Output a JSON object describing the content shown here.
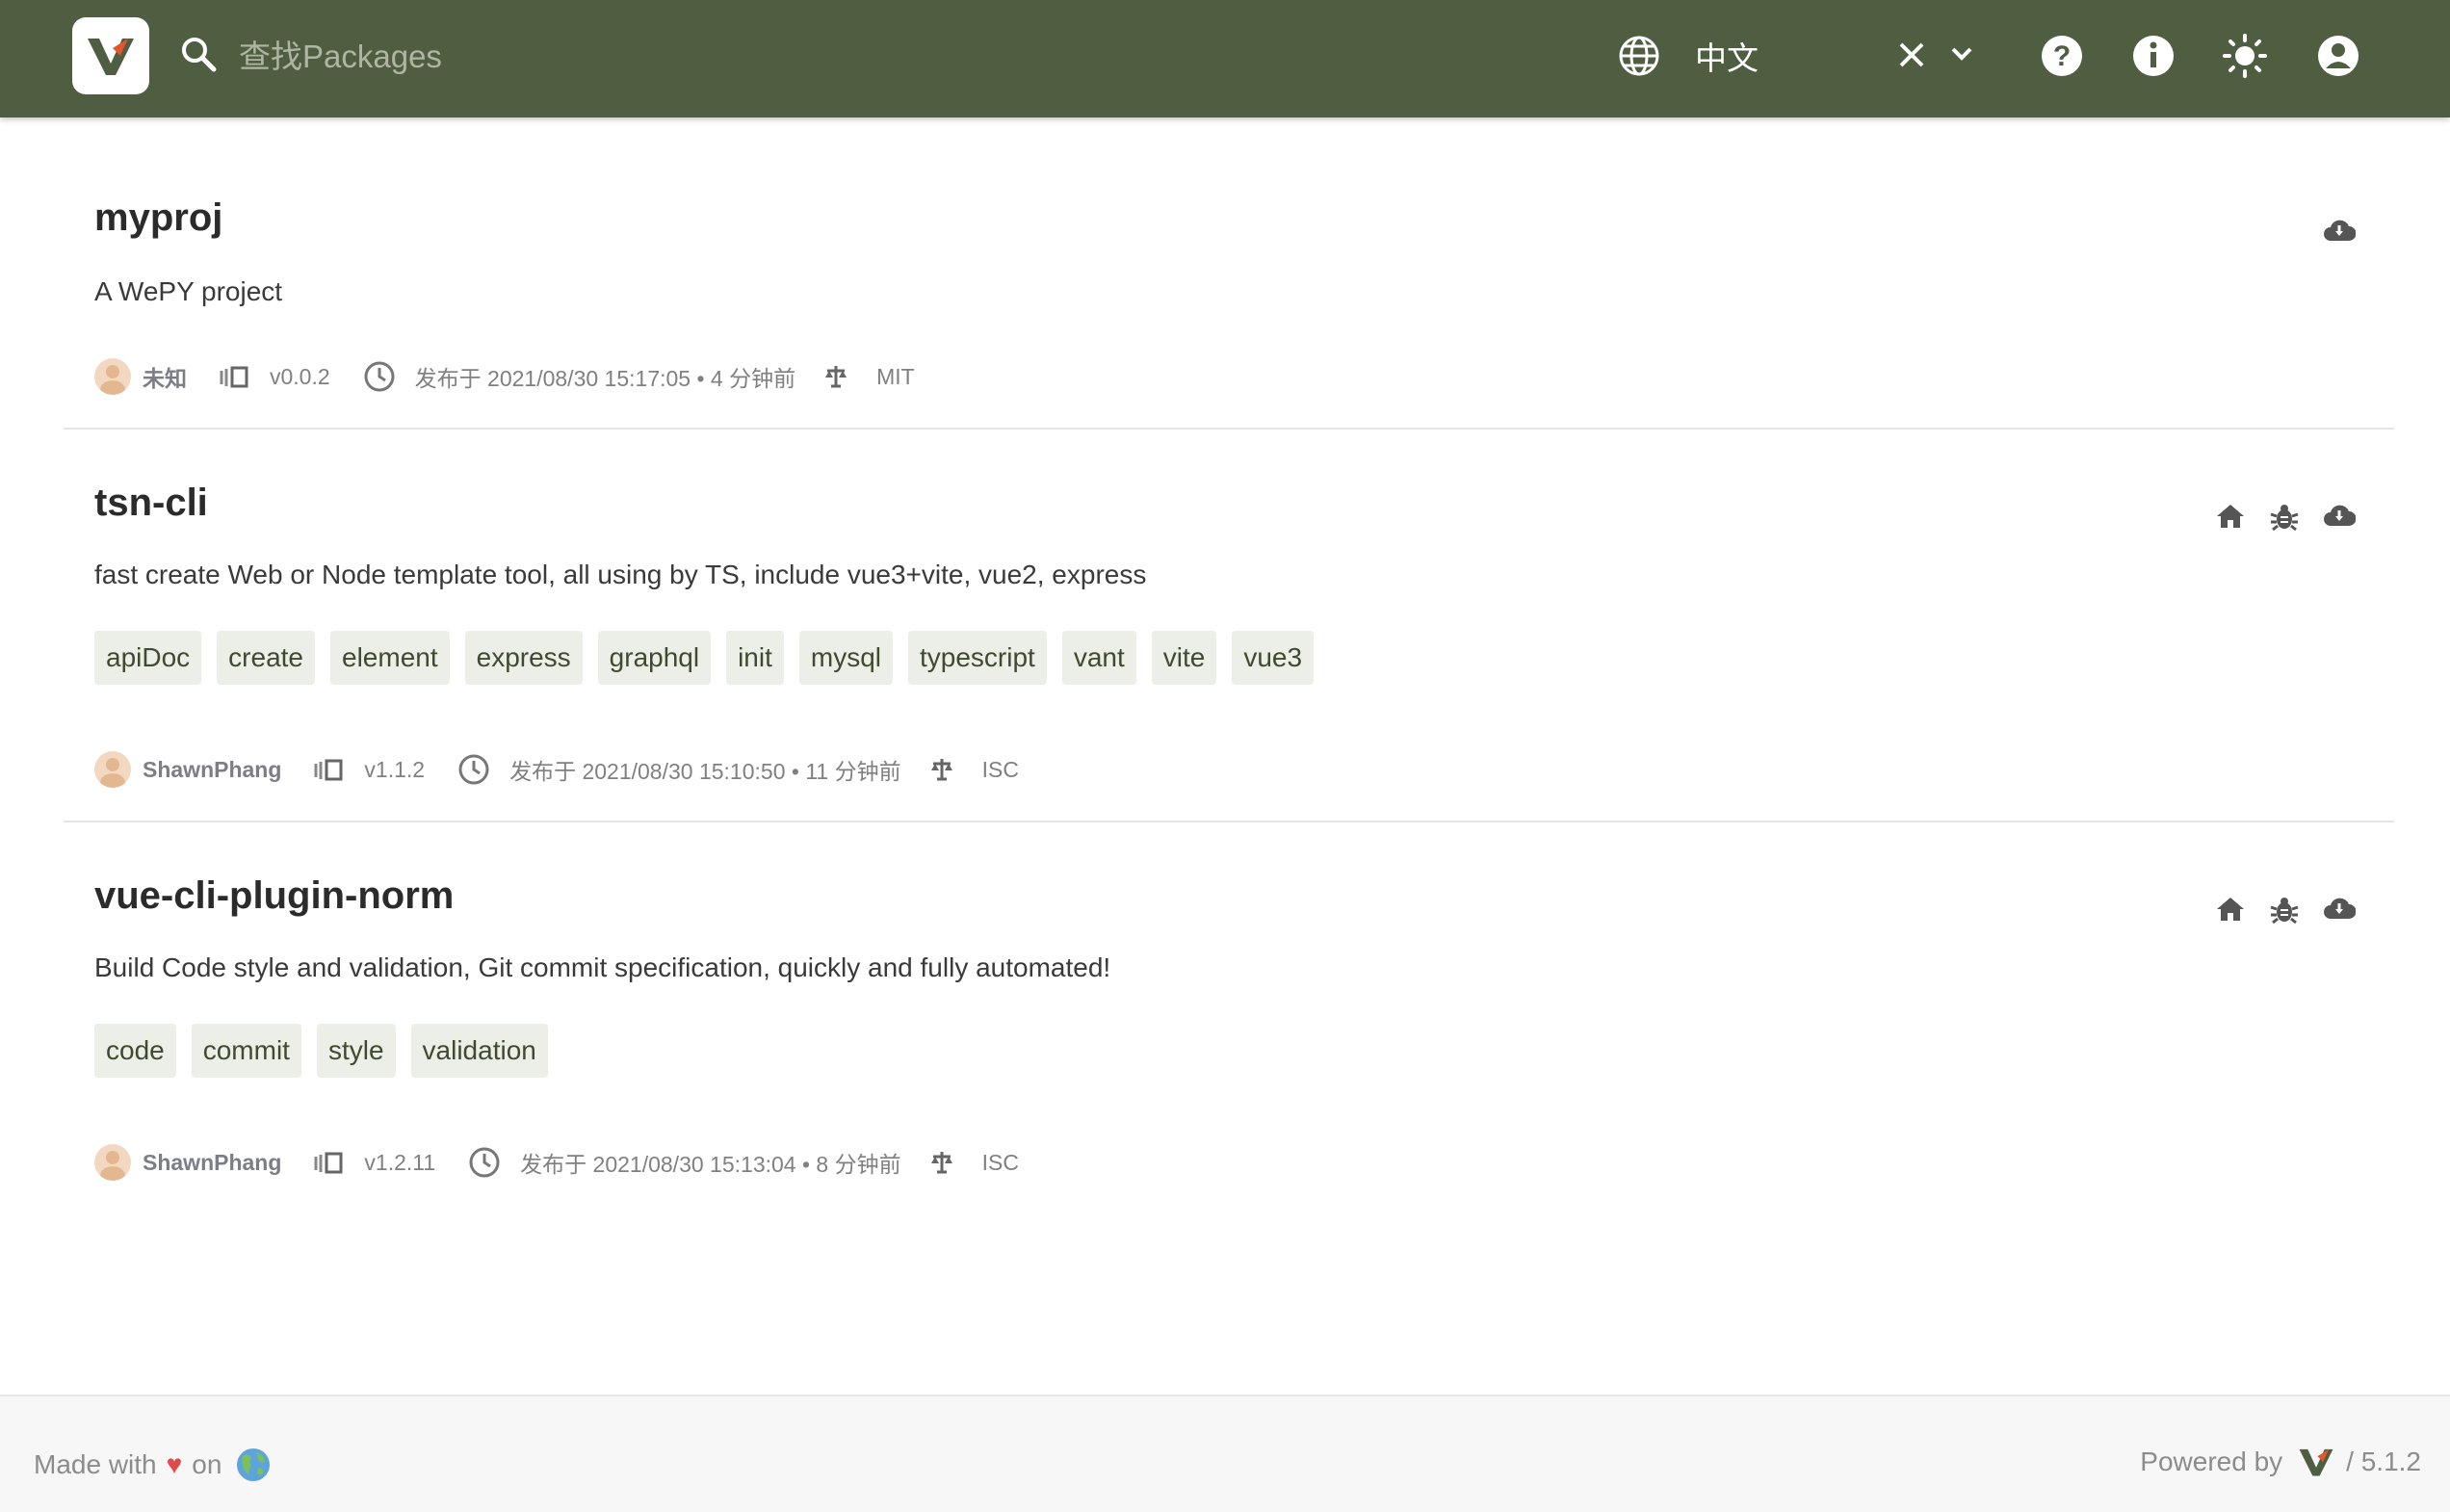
{
  "header": {
    "search_placeholder": "查找Packages",
    "language": "中文",
    "accent_color": "#4f5e40",
    "icons": [
      "search-icon",
      "globe-icon",
      "close-icon",
      "chevron-down-icon",
      "help-icon",
      "info-icon",
      "theme-icon",
      "account-icon"
    ]
  },
  "packages": [
    {
      "name": "myproj",
      "description": "A WePY project",
      "keywords": [],
      "author": "未知",
      "version": "v0.0.2",
      "published": "发布于 2021/08/30 15:17:05 • 4 分钟前",
      "license": "MIT",
      "actions": [
        "download-icon"
      ]
    },
    {
      "name": "tsn-cli",
      "description": "fast create Web or Node template tool, all using by TS, include vue3+vite, vue2, express",
      "keywords": [
        "apiDoc",
        "create",
        "element",
        "express",
        "graphql",
        "init",
        "mysql",
        "typescript",
        "vant",
        "vite",
        "vue3"
      ],
      "author": "ShawnPhang",
      "version": "v1.1.2",
      "published": "发布于 2021/08/30 15:10:50 • 11 分钟前",
      "license": "ISC",
      "actions": [
        "home-icon",
        "bug-icon",
        "download-icon"
      ]
    },
    {
      "name": "vue-cli-plugin-norm",
      "description": "Build Code style and validation, Git commit specification, quickly and fully automated!",
      "keywords": [
        "code",
        "commit",
        "style",
        "validation"
      ],
      "author": "ShawnPhang",
      "version": "v1.2.11",
      "published": "发布于 2021/08/30 15:13:04 • 8 分钟前",
      "license": "ISC",
      "actions": [
        "home-icon",
        "bug-icon",
        "download-icon"
      ]
    }
  ],
  "footer": {
    "made_with": "Made with",
    "on": "on",
    "powered_by": "Powered by",
    "version": "/ 5.1.2"
  }
}
